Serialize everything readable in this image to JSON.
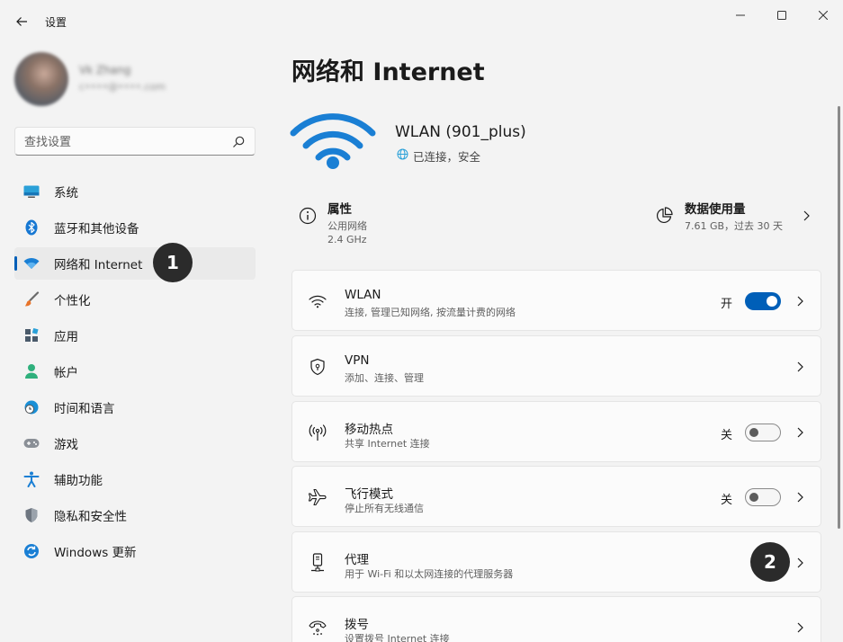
{
  "window": {
    "app_title": "设置"
  },
  "profile": {
    "name": "Vk Zhang",
    "email": "c••••@••••.com"
  },
  "search": {
    "placeholder": "查找设置"
  },
  "sidebar": {
    "items": [
      {
        "label": "系统",
        "icon": "system-monitor-icon"
      },
      {
        "label": "蓝牙和其他设备",
        "icon": "bluetooth-icon"
      },
      {
        "label": "网络和 Internet",
        "icon": "wifi-icon",
        "active": true
      },
      {
        "label": "个性化",
        "icon": "paintbrush-icon"
      },
      {
        "label": "应用",
        "icon": "apps-icon"
      },
      {
        "label": "帐户",
        "icon": "person-icon"
      },
      {
        "label": "时间和语言",
        "icon": "clock-globe-icon"
      },
      {
        "label": "游戏",
        "icon": "gamepad-icon"
      },
      {
        "label": "辅助功能",
        "icon": "accessibility-icon"
      },
      {
        "label": "隐私和安全性",
        "icon": "shield-icon"
      },
      {
        "label": "Windows 更新",
        "icon": "update-icon"
      }
    ]
  },
  "badges": [
    "1",
    "2"
  ],
  "main": {
    "title": "网络和 Internet",
    "network": {
      "name": "WLAN (901_plus)",
      "status": "已连接，安全"
    },
    "properties": {
      "title": "属性",
      "line1": "公用网络",
      "line2": "2.4 GHz"
    },
    "data_usage": {
      "title": "数据使用量",
      "subtitle": "7.61 GB，过去 30 天"
    },
    "cards": [
      {
        "title": "WLAN",
        "subtitle": "连接, 管理已知网络, 按流量计费的网络",
        "toggle_label": "开",
        "toggle_on": true,
        "icon": "wifi-icon"
      },
      {
        "title": "VPN",
        "subtitle": "添加、连接、管理",
        "icon": "shield-vpn-icon"
      },
      {
        "title": "移动热点",
        "subtitle": "共享 Internet 连接",
        "toggle_label": "关",
        "toggle_on": false,
        "icon": "hotspot-icon"
      },
      {
        "title": "飞行模式",
        "subtitle": "停止所有无线通信",
        "toggle_label": "关",
        "toggle_on": false,
        "icon": "airplane-icon"
      },
      {
        "title": "代理",
        "subtitle": "用于 Wi-Fi 和以太网连接的代理服务器",
        "icon": "proxy-icon"
      },
      {
        "title": "拨号",
        "subtitle": "设置拨号 Internet 连接",
        "icon": "dialup-icon"
      }
    ]
  },
  "colors": {
    "accent": "#005fb8",
    "wifi_hero": "#1a7fd4",
    "background": "#f3f3f3"
  }
}
